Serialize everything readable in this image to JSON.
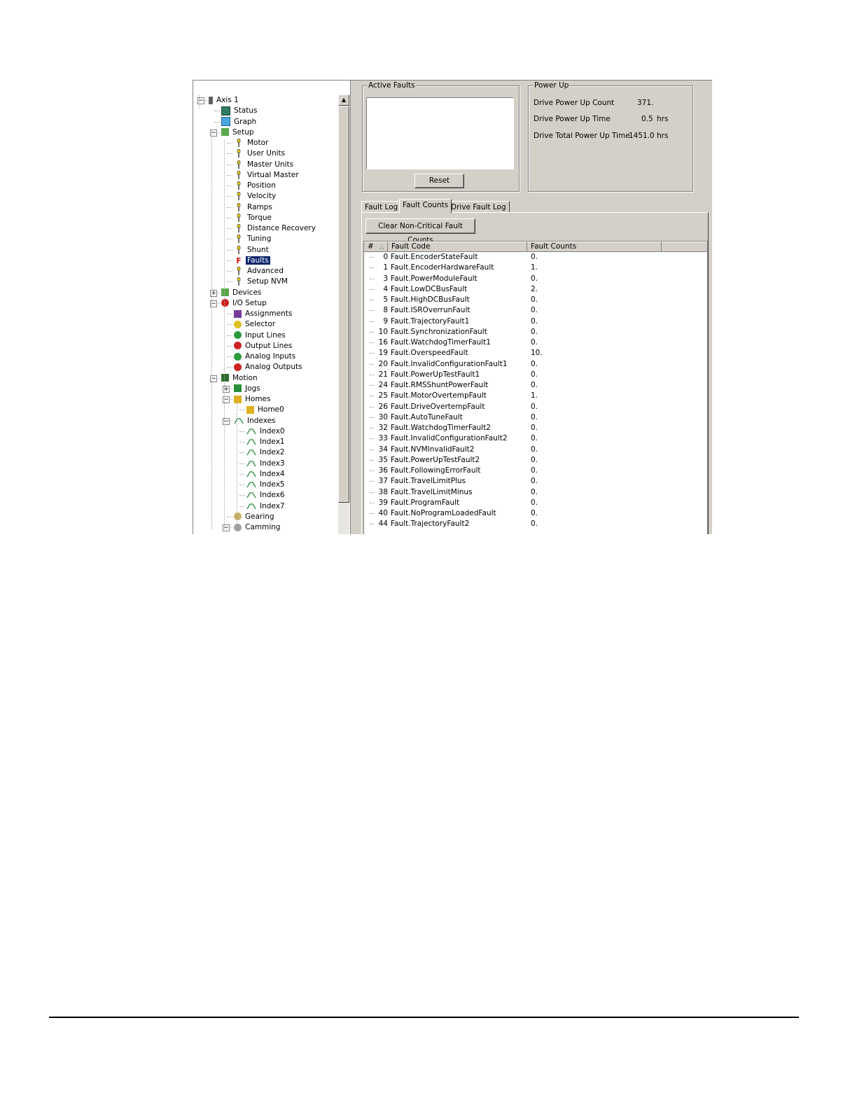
{
  "tree": {
    "nodes": [
      {
        "label": "Axis 1",
        "icon": "axis-icon",
        "level": 0,
        "expander": "minus"
      },
      {
        "label": "Status",
        "icon": "status-icon",
        "level": 1
      },
      {
        "label": "Graph",
        "icon": "graph-icon",
        "level": 1
      },
      {
        "label": "Setup",
        "icon": "setup-icon",
        "level": 1,
        "expander": "minus"
      },
      {
        "label": "Motor",
        "icon": "motor-icon",
        "level": 2
      },
      {
        "label": "User Units",
        "icon": "user-units-icon",
        "level": 2
      },
      {
        "label": "Master Units",
        "icon": "master-units-icon",
        "level": 2
      },
      {
        "label": "Virtual Master",
        "icon": "virtual-master-icon",
        "level": 2
      },
      {
        "label": "Position",
        "icon": "position-icon",
        "level": 2
      },
      {
        "label": "Velocity",
        "icon": "velocity-icon",
        "level": 2
      },
      {
        "label": "Ramps",
        "icon": "ramps-icon",
        "level": 2
      },
      {
        "label": "Torque",
        "icon": "torque-icon",
        "level": 2
      },
      {
        "label": "Distance Recovery",
        "icon": "distance-recovery-icon",
        "level": 2
      },
      {
        "label": "Tuning",
        "icon": "tuning-icon",
        "level": 2
      },
      {
        "label": "Shunt",
        "icon": "shunt-icon",
        "level": 2
      },
      {
        "label": "Faults",
        "icon": "faults-icon",
        "level": 2,
        "selected": true
      },
      {
        "label": "Advanced",
        "icon": "advanced-icon",
        "level": 2
      },
      {
        "label": "Setup NVM",
        "icon": "setup-nvm-icon",
        "level": 2
      },
      {
        "label": "Devices",
        "icon": "devices-icon",
        "level": 1,
        "expander": "plus"
      },
      {
        "label": "I/O Setup",
        "icon": "io-setup-icon",
        "level": 1,
        "expander": "minus"
      },
      {
        "label": "Assignments",
        "icon": "assignments-icon",
        "level": 2
      },
      {
        "label": "Selector",
        "icon": "selector-icon",
        "level": 2
      },
      {
        "label": "Input Lines",
        "icon": "input-lines-icon",
        "level": 2
      },
      {
        "label": "Output Lines",
        "icon": "output-lines-icon",
        "level": 2
      },
      {
        "label": "Analog Inputs",
        "icon": "analog-inputs-icon",
        "level": 2
      },
      {
        "label": "Analog Outputs",
        "icon": "analog-outputs-icon",
        "level": 2
      },
      {
        "label": "Motion",
        "icon": "motion-icon",
        "level": 1,
        "expander": "minus"
      },
      {
        "label": "Jogs",
        "icon": "jogs-icon",
        "level": 2,
        "expander": "plus"
      },
      {
        "label": "Homes",
        "icon": "homes-icon",
        "level": 2,
        "expander": "minus"
      },
      {
        "label": "Home0",
        "icon": "home-icon",
        "level": 3
      },
      {
        "label": "Indexes",
        "icon": "indexes-icon",
        "level": 2,
        "expander": "minus"
      },
      {
        "label": "Index0",
        "icon": "index-icon",
        "level": 3
      },
      {
        "label": "Index1",
        "icon": "index-icon",
        "level": 3
      },
      {
        "label": "Index2",
        "icon": "index-icon",
        "level": 3
      },
      {
        "label": "Index3",
        "icon": "index-icon",
        "level": 3
      },
      {
        "label": "Index4",
        "icon": "index-icon",
        "level": 3
      },
      {
        "label": "Index5",
        "icon": "index-icon",
        "level": 3
      },
      {
        "label": "Index6",
        "icon": "index-icon",
        "level": 3
      },
      {
        "label": "Index7",
        "icon": "index-icon",
        "level": 3
      },
      {
        "label": "Gearing",
        "icon": "gearing-icon",
        "level": 2
      },
      {
        "label": "Camming",
        "icon": "camming-icon",
        "level": 2,
        "expander": "minus"
      }
    ]
  },
  "active_faults": {
    "legend": "Active Faults",
    "reset_label": "Reset"
  },
  "power_up": {
    "legend": "Power Up",
    "rows": [
      {
        "label": "Drive Power Up Count",
        "value": "371.",
        "unit": ""
      },
      {
        "label": "Drive Power Up Time",
        "value": "0.5",
        "unit": "hrs"
      },
      {
        "label": "Drive Total Power Up Time",
        "value": "1451.0",
        "unit": "hrs"
      }
    ]
  },
  "tabs": [
    {
      "label": "Fault Log",
      "active": false
    },
    {
      "label": "Fault Counts",
      "active": true
    },
    {
      "label": "Drive Fault Log",
      "active": false
    }
  ],
  "clear_button_label": "Clear Non-Critical Fault Counts",
  "grid": {
    "columns": [
      "#",
      "Fault Code",
      "Fault Counts"
    ],
    "rows": [
      {
        "num": "0",
        "code": "Fault.EncoderStateFault",
        "count": "0."
      },
      {
        "num": "1",
        "code": "Fault.EncoderHardwareFault",
        "count": "1."
      },
      {
        "num": "3",
        "code": "Fault.PowerModuleFault",
        "count": "0."
      },
      {
        "num": "4",
        "code": "Fault.LowDCBusFault",
        "count": "2."
      },
      {
        "num": "5",
        "code": "Fault.HighDCBusFault",
        "count": "0."
      },
      {
        "num": "8",
        "code": "Fault.ISROverrunFault",
        "count": "0."
      },
      {
        "num": "9",
        "code": "Fault.TrajectoryFault1",
        "count": "0."
      },
      {
        "num": "10",
        "code": "Fault.SynchronizationFault",
        "count": "0."
      },
      {
        "num": "16",
        "code": "Fault.WatchdogTimerFault1",
        "count": "0."
      },
      {
        "num": "19",
        "code": "Fault.OverspeedFault",
        "count": "10."
      },
      {
        "num": "20",
        "code": "Fault.InvalidConfigurationFault1",
        "count": "0."
      },
      {
        "num": "21",
        "code": "Fault.PowerUpTestFault1",
        "count": "0."
      },
      {
        "num": "24",
        "code": "Fault.RMSShuntPowerFault",
        "count": "0."
      },
      {
        "num": "25",
        "code": "Fault.MotorOvertempFault",
        "count": "1."
      },
      {
        "num": "26",
        "code": "Fault.DriveOvertempFault",
        "count": "0."
      },
      {
        "num": "30",
        "code": "Fault.AutoTuneFault",
        "count": "0."
      },
      {
        "num": "32",
        "code": "Fault.WatchdogTimerFault2",
        "count": "0."
      },
      {
        "num": "33",
        "code": "Fault.InvalidConfigurationFault2",
        "count": "0."
      },
      {
        "num": "34",
        "code": "Fault.NVMInvalidFault2",
        "count": "0."
      },
      {
        "num": "35",
        "code": "Fault.PowerUpTestFault2",
        "count": "0."
      },
      {
        "num": "36",
        "code": "Fault.FollowingErrorFault",
        "count": "0."
      },
      {
        "num": "37",
        "code": "Fault.TravelLimitPlus",
        "count": "0."
      },
      {
        "num": "38",
        "code": "Fault.TravelLimitMinus",
        "count": "0."
      },
      {
        "num": "39",
        "code": "Fault.ProgramFault",
        "count": "0."
      },
      {
        "num": "40",
        "code": "Fault.NoProgramLoadedFault",
        "count": "0."
      },
      {
        "num": "44",
        "code": "Fault.TrajectoryFault2",
        "count": "0."
      }
    ]
  },
  "colors": {
    "face": "#d4d0c8",
    "selection": "#0a246a"
  }
}
